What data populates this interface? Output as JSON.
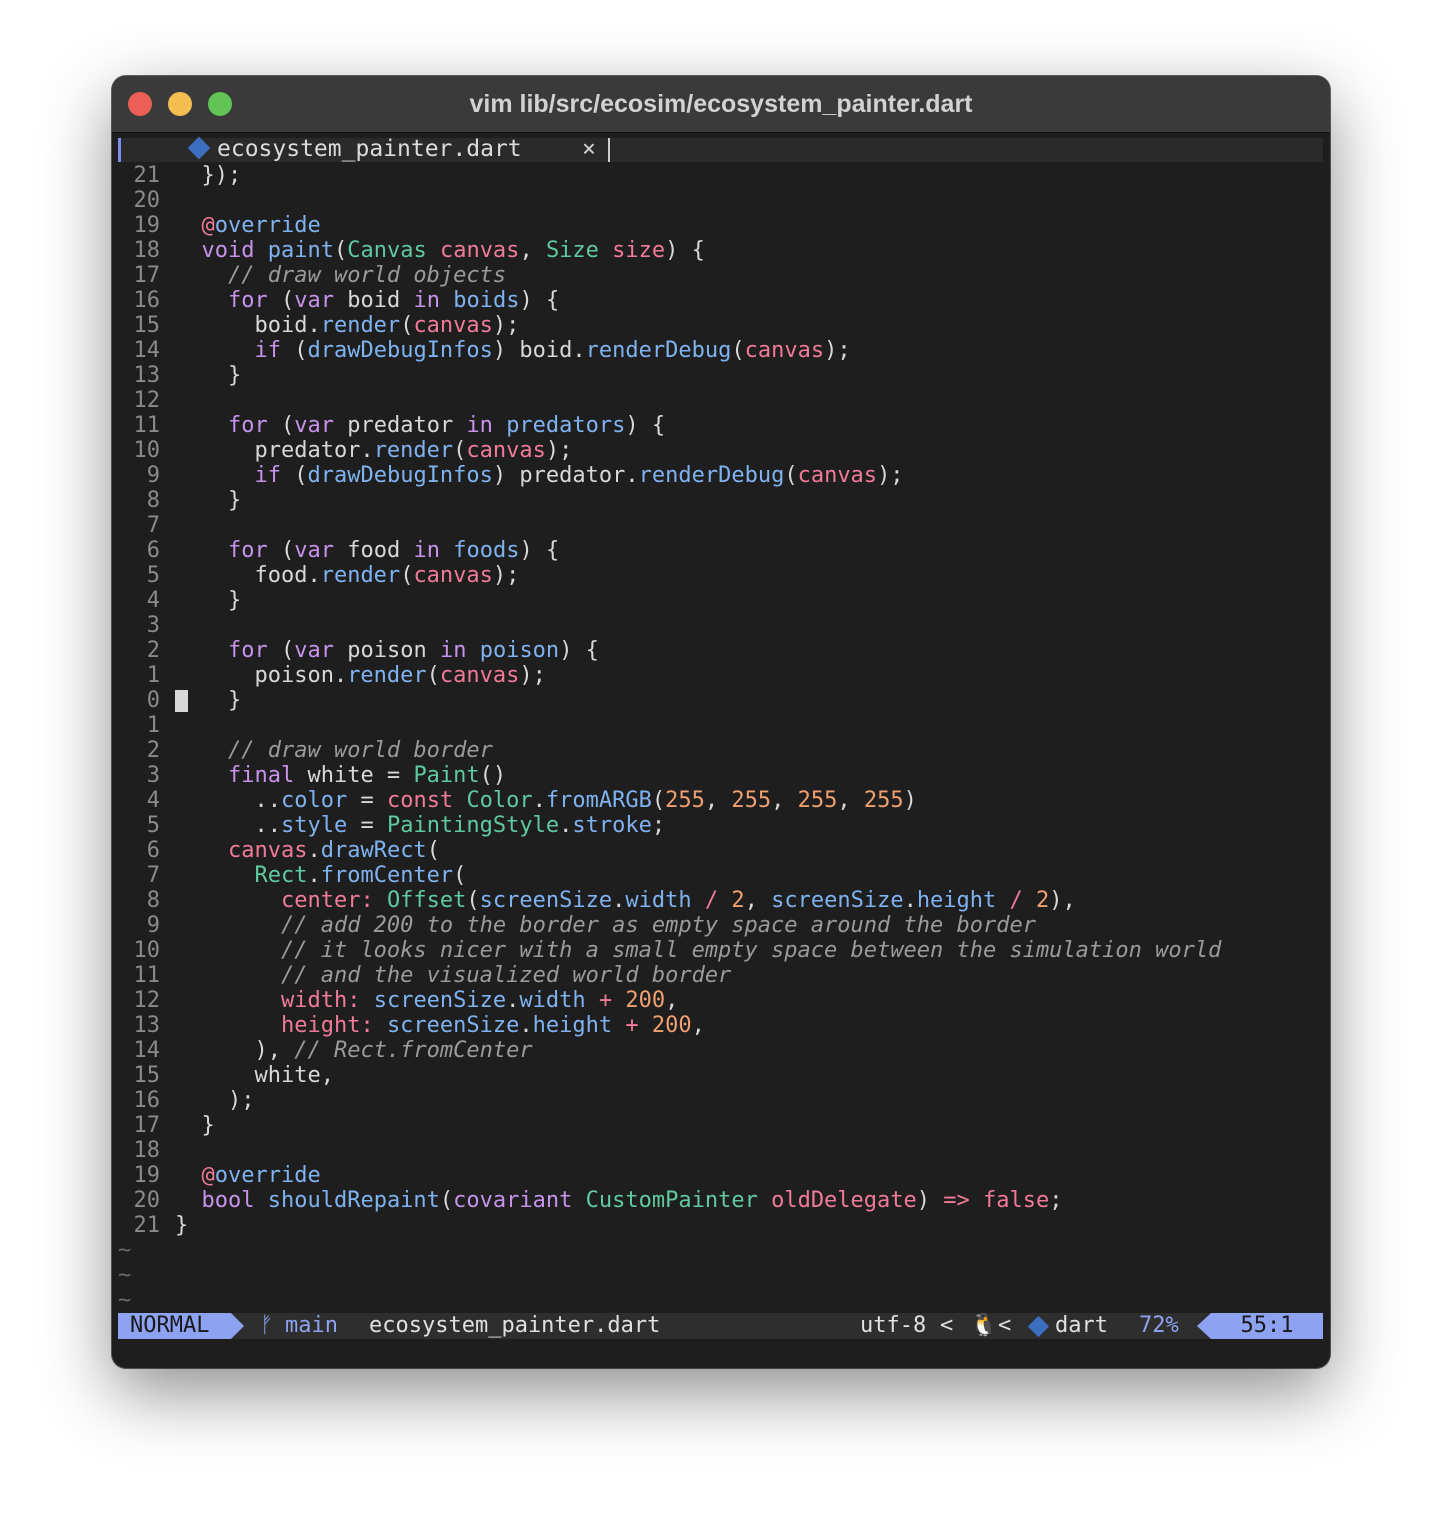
{
  "window": {
    "title": "vim lib/src/ecosim/ecosystem_painter.dart"
  },
  "tab": {
    "label": "ecosystem_painter.dart",
    "close": "×",
    "icon": "dart-diamond-icon"
  },
  "colors": {
    "keyword": "#c792ea",
    "type": "#5fc9a0",
    "function": "#7fb2f0",
    "param": "#f07a98",
    "number": "#f0a070",
    "comment": "#9a9a9a",
    "default": "#d8d8d8"
  },
  "code_lines": [
    {
      "num": "21",
      "tokens": [
        [
          "  });",
          "d"
        ]
      ]
    },
    {
      "num": "20",
      "tokens": []
    },
    {
      "num": "19",
      "tokens": [
        [
          "  ",
          "d"
        ],
        [
          "@",
          "p"
        ],
        [
          "override",
          "f"
        ]
      ]
    },
    {
      "num": "18",
      "tokens": [
        [
          "  ",
          "d"
        ],
        [
          "void",
          "k"
        ],
        [
          " ",
          "d"
        ],
        [
          "paint",
          "f"
        ],
        [
          "(",
          "d"
        ],
        [
          "Canvas",
          "t"
        ],
        [
          " ",
          "d"
        ],
        [
          "canvas",
          "p"
        ],
        [
          ", ",
          "d"
        ],
        [
          "Size",
          "t"
        ],
        [
          " ",
          "d"
        ],
        [
          "size",
          "p"
        ],
        [
          ") {",
          "d"
        ]
      ]
    },
    {
      "num": "17",
      "tokens": [
        [
          "    ",
          "d"
        ],
        [
          "// draw world objects",
          "c"
        ]
      ]
    },
    {
      "num": "16",
      "tokens": [
        [
          "    ",
          "d"
        ],
        [
          "for",
          "k"
        ],
        [
          " (",
          "d"
        ],
        [
          "var",
          "k"
        ],
        [
          " boid ",
          "d"
        ],
        [
          "in",
          "k"
        ],
        [
          " ",
          "d"
        ],
        [
          "boids",
          "f"
        ],
        [
          ") {",
          "d"
        ]
      ]
    },
    {
      "num": "15",
      "tokens": [
        [
          "      boid.",
          "d"
        ],
        [
          "render",
          "f"
        ],
        [
          "(",
          "d"
        ],
        [
          "canvas",
          "p"
        ],
        [
          ");",
          "d"
        ]
      ]
    },
    {
      "num": "14",
      "tokens": [
        [
          "      ",
          "d"
        ],
        [
          "if",
          "k"
        ],
        [
          " (",
          "d"
        ],
        [
          "drawDebugInfos",
          "f"
        ],
        [
          ") boid.",
          "d"
        ],
        [
          "renderDebug",
          "f"
        ],
        [
          "(",
          "d"
        ],
        [
          "canvas",
          "p"
        ],
        [
          ");",
          "d"
        ]
      ]
    },
    {
      "num": "13",
      "tokens": [
        [
          "    }",
          "d"
        ]
      ]
    },
    {
      "num": "12",
      "tokens": []
    },
    {
      "num": "11",
      "tokens": [
        [
          "    ",
          "d"
        ],
        [
          "for",
          "k"
        ],
        [
          " (",
          "d"
        ],
        [
          "var",
          "k"
        ],
        [
          " predator ",
          "d"
        ],
        [
          "in",
          "k"
        ],
        [
          " ",
          "d"
        ],
        [
          "predators",
          "f"
        ],
        [
          ") {",
          "d"
        ]
      ]
    },
    {
      "num": "10",
      "tokens": [
        [
          "      predator.",
          "d"
        ],
        [
          "render",
          "f"
        ],
        [
          "(",
          "d"
        ],
        [
          "canvas",
          "p"
        ],
        [
          ");",
          "d"
        ]
      ]
    },
    {
      "num": "9",
      "tokens": [
        [
          "      ",
          "d"
        ],
        [
          "if",
          "k"
        ],
        [
          " (",
          "d"
        ],
        [
          "drawDebugInfos",
          "f"
        ],
        [
          ") predator.",
          "d"
        ],
        [
          "renderDebug",
          "f"
        ],
        [
          "(",
          "d"
        ],
        [
          "canvas",
          "p"
        ],
        [
          ");",
          "d"
        ]
      ]
    },
    {
      "num": "8",
      "tokens": [
        [
          "    }",
          "d"
        ]
      ]
    },
    {
      "num": "7",
      "tokens": []
    },
    {
      "num": "6",
      "tokens": [
        [
          "    ",
          "d"
        ],
        [
          "for",
          "k"
        ],
        [
          " (",
          "d"
        ],
        [
          "var",
          "k"
        ],
        [
          " food ",
          "d"
        ],
        [
          "in",
          "k"
        ],
        [
          " ",
          "d"
        ],
        [
          "foods",
          "f"
        ],
        [
          ") {",
          "d"
        ]
      ]
    },
    {
      "num": "5",
      "tokens": [
        [
          "      food.",
          "d"
        ],
        [
          "render",
          "f"
        ],
        [
          "(",
          "d"
        ],
        [
          "canvas",
          "p"
        ],
        [
          ");",
          "d"
        ]
      ]
    },
    {
      "num": "4",
      "tokens": [
        [
          "    }",
          "d"
        ]
      ]
    },
    {
      "num": "3",
      "tokens": []
    },
    {
      "num": "2",
      "tokens": [
        [
          "    ",
          "d"
        ],
        [
          "for",
          "k"
        ],
        [
          " (",
          "d"
        ],
        [
          "var",
          "k"
        ],
        [
          " poison ",
          "d"
        ],
        [
          "in",
          "k"
        ],
        [
          " ",
          "d"
        ],
        [
          "poison",
          "f"
        ],
        [
          ") {",
          "d"
        ]
      ]
    },
    {
      "num": "1",
      "tokens": [
        [
          "      poison.",
          "d"
        ],
        [
          "render",
          "f"
        ],
        [
          "(",
          "d"
        ],
        [
          "canvas",
          "p"
        ],
        [
          ");",
          "d"
        ]
      ]
    },
    {
      "num": "0",
      "tokens": [
        [
          "    }",
          "d"
        ]
      ],
      "cursor": true
    },
    {
      "num": "1",
      "tokens": []
    },
    {
      "num": "2",
      "tokens": [
        [
          "    ",
          "d"
        ],
        [
          "// draw world border",
          "c"
        ]
      ]
    },
    {
      "num": "3",
      "tokens": [
        [
          "    ",
          "d"
        ],
        [
          "final",
          "k"
        ],
        [
          " white = ",
          "d"
        ],
        [
          "Paint",
          "t"
        ],
        [
          "()",
          "d"
        ]
      ]
    },
    {
      "num": "4",
      "tokens": [
        [
          "      ..",
          "d"
        ],
        [
          "color",
          "f"
        ],
        [
          " = ",
          "d"
        ],
        [
          "const",
          "p"
        ],
        [
          " ",
          "d"
        ],
        [
          "Color",
          "t"
        ],
        [
          ".",
          "d"
        ],
        [
          "fromARGB",
          "f"
        ],
        [
          "(",
          "d"
        ],
        [
          "255",
          "n"
        ],
        [
          ", ",
          "d"
        ],
        [
          "255",
          "n"
        ],
        [
          ", ",
          "d"
        ],
        [
          "255",
          "n"
        ],
        [
          ", ",
          "d"
        ],
        [
          "255",
          "n"
        ],
        [
          ")",
          "d"
        ]
      ]
    },
    {
      "num": "5",
      "tokens": [
        [
          "      ..",
          "d"
        ],
        [
          "style",
          "f"
        ],
        [
          " = ",
          "d"
        ],
        [
          "PaintingStyle",
          "t"
        ],
        [
          ".",
          "d"
        ],
        [
          "stroke",
          "f"
        ],
        [
          ";",
          "d"
        ]
      ]
    },
    {
      "num": "6",
      "tokens": [
        [
          "    ",
          "d"
        ],
        [
          "canvas",
          "p"
        ],
        [
          ".",
          "d"
        ],
        [
          "drawRect",
          "f"
        ],
        [
          "(",
          "d"
        ]
      ]
    },
    {
      "num": "7",
      "tokens": [
        [
          "      ",
          "d"
        ],
        [
          "Rect",
          "t"
        ],
        [
          ".",
          "d"
        ],
        [
          "fromCenter",
          "f"
        ],
        [
          "(",
          "d"
        ]
      ]
    },
    {
      "num": "8",
      "tokens": [
        [
          "        ",
          "d"
        ],
        [
          "center:",
          "p"
        ],
        [
          " ",
          "d"
        ],
        [
          "Offset",
          "t"
        ],
        [
          "(",
          "d"
        ],
        [
          "screenSize",
          "f"
        ],
        [
          ".",
          "d"
        ],
        [
          "width",
          "f"
        ],
        [
          " ",
          "d"
        ],
        [
          "/",
          "p"
        ],
        [
          " ",
          "d"
        ],
        [
          "2",
          "n"
        ],
        [
          ", ",
          "d"
        ],
        [
          "screenSize",
          "f"
        ],
        [
          ".",
          "d"
        ],
        [
          "height",
          "f"
        ],
        [
          " ",
          "d"
        ],
        [
          "/",
          "p"
        ],
        [
          " ",
          "d"
        ],
        [
          "2",
          "n"
        ],
        [
          "),",
          "d"
        ]
      ]
    },
    {
      "num": "9",
      "tokens": [
        [
          "        ",
          "d"
        ],
        [
          "// add 200 to the border as empty space around the border",
          "c"
        ]
      ]
    },
    {
      "num": "10",
      "tokens": [
        [
          "        ",
          "d"
        ],
        [
          "// it looks nicer with a small empty space between the simulation world",
          "c"
        ]
      ]
    },
    {
      "num": "11",
      "tokens": [
        [
          "        ",
          "d"
        ],
        [
          "// and the visualized world border",
          "c"
        ]
      ]
    },
    {
      "num": "12",
      "tokens": [
        [
          "        ",
          "d"
        ],
        [
          "width:",
          "p"
        ],
        [
          " ",
          "d"
        ],
        [
          "screenSize",
          "f"
        ],
        [
          ".",
          "d"
        ],
        [
          "width",
          "f"
        ],
        [
          " ",
          "d"
        ],
        [
          "+",
          "p"
        ],
        [
          " ",
          "d"
        ],
        [
          "200",
          "n"
        ],
        [
          ",",
          "d"
        ]
      ]
    },
    {
      "num": "13",
      "tokens": [
        [
          "        ",
          "d"
        ],
        [
          "height:",
          "p"
        ],
        [
          " ",
          "d"
        ],
        [
          "screenSize",
          "f"
        ],
        [
          ".",
          "d"
        ],
        [
          "height",
          "f"
        ],
        [
          " ",
          "d"
        ],
        [
          "+",
          "p"
        ],
        [
          " ",
          "d"
        ],
        [
          "200",
          "n"
        ],
        [
          ",",
          "d"
        ]
      ]
    },
    {
      "num": "14",
      "tokens": [
        [
          "      ), ",
          "d"
        ],
        [
          "// Rect.fromCenter",
          "c"
        ]
      ]
    },
    {
      "num": "15",
      "tokens": [
        [
          "      white,",
          "d"
        ]
      ]
    },
    {
      "num": "16",
      "tokens": [
        [
          "    );",
          "d"
        ]
      ]
    },
    {
      "num": "17",
      "tokens": [
        [
          "  }",
          "d"
        ]
      ]
    },
    {
      "num": "18",
      "tokens": []
    },
    {
      "num": "19",
      "tokens": [
        [
          "  ",
          "d"
        ],
        [
          "@",
          "p"
        ],
        [
          "override",
          "f"
        ]
      ]
    },
    {
      "num": "20",
      "tokens": [
        [
          "  ",
          "d"
        ],
        [
          "bool",
          "k"
        ],
        [
          " ",
          "d"
        ],
        [
          "shouldRepaint",
          "f"
        ],
        [
          "(",
          "d"
        ],
        [
          "covariant",
          "k"
        ],
        [
          " ",
          "d"
        ],
        [
          "CustomPainter",
          "t"
        ],
        [
          " ",
          "d"
        ],
        [
          "oldDelegate",
          "p"
        ],
        [
          ") ",
          "d"
        ],
        [
          "=>",
          "p"
        ],
        [
          " ",
          "d"
        ],
        [
          "false",
          "p"
        ],
        [
          ";",
          "d"
        ]
      ]
    },
    {
      "num": "21",
      "tokens": [
        [
          "}",
          "d"
        ]
      ]
    }
  ],
  "empty_line_markers": [
    "~",
    "~",
    "~"
  ],
  "statusline": {
    "mode": "NORMAL",
    "branch_icon": "ᚠ",
    "branch": "main",
    "file": "ecosystem_painter.dart",
    "encoding": "utf-8",
    "separator": "<",
    "os_icon": "linux-penguin-icon",
    "os_glyph": "🐧",
    "filetype": "dart",
    "percent": "72%",
    "position": "55:1"
  }
}
